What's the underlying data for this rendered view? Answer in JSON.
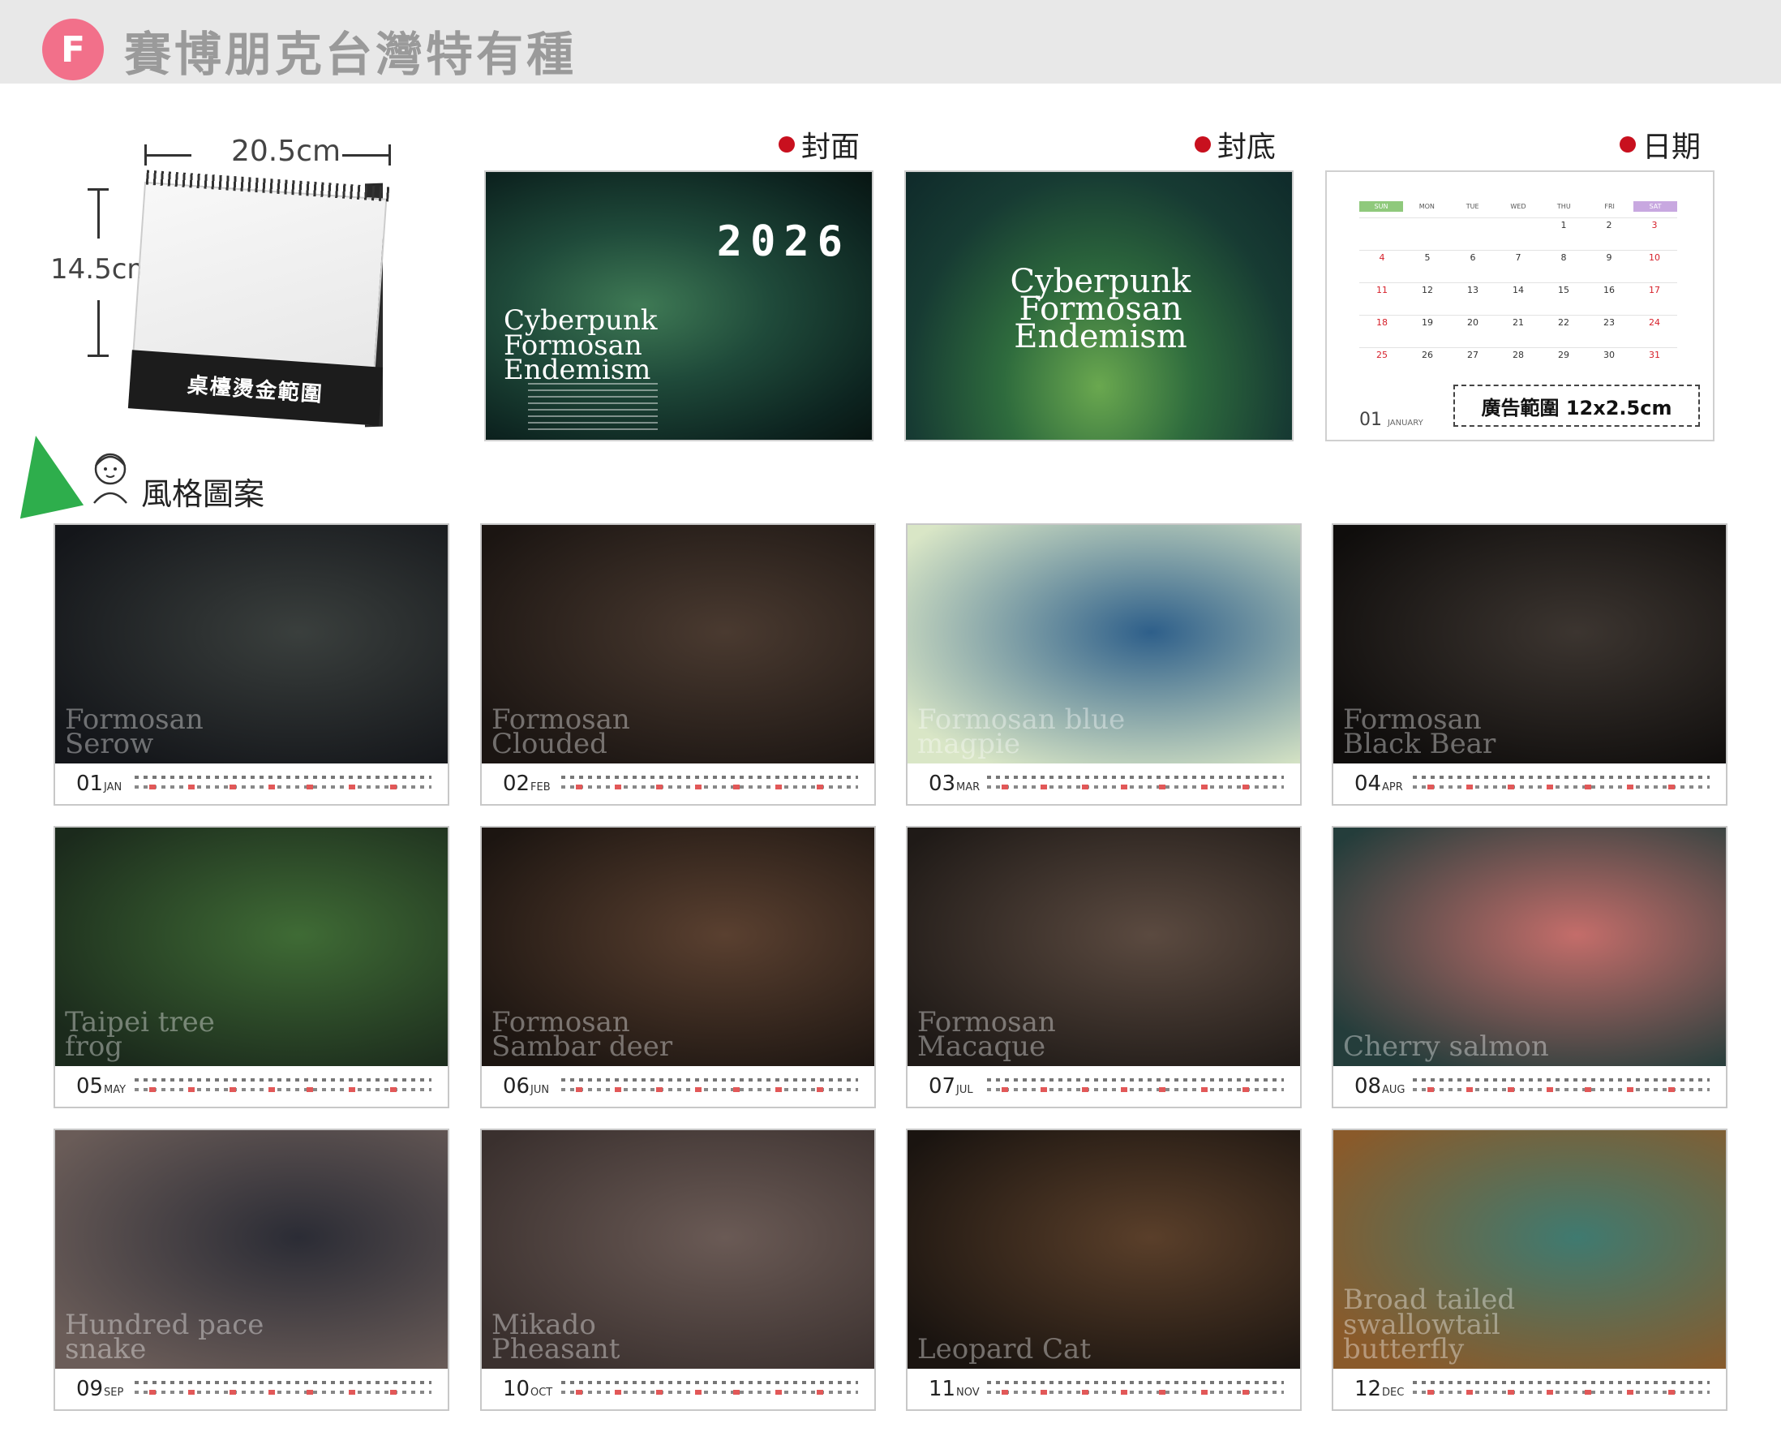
{
  "header": {
    "badge": "F",
    "title": "賽博朋克台灣特有種"
  },
  "mockup": {
    "width_label": "20.5cm",
    "height_label": "14.5cm",
    "base_text": "桌檯燙金範圍"
  },
  "panels": {
    "cover": {
      "label": "封面",
      "year": "2026",
      "title_lines": [
        "Cyberpunk",
        "Formosan",
        "Endemism"
      ]
    },
    "back": {
      "label": "封底",
      "title_lines": [
        "Cyberpunk",
        "Formosan",
        "Endemism"
      ]
    },
    "date": {
      "label": "日期",
      "weekdays": [
        "SUN",
        "MON",
        "TUE",
        "WED",
        "THU",
        "FRI",
        "SAT"
      ],
      "days": [
        "",
        "",
        "",
        "",
        "1",
        "2",
        "3",
        "4",
        "5",
        "6",
        "7",
        "8",
        "9",
        "10",
        "11",
        "12",
        "13",
        "14",
        "15",
        "16",
        "17",
        "18",
        "19",
        "20",
        "21",
        "22",
        "23",
        "24",
        "25",
        "26",
        "27",
        "28",
        "29",
        "30",
        "31"
      ],
      "month_num": "01",
      "month_name": "JANUARY",
      "ad_text": "廣告範圍 12x2.5cm"
    }
  },
  "style_section": {
    "label": "風格圖案"
  },
  "months": [
    {
      "num": "01",
      "abbr": "JAN",
      "name": "Formosan Serow",
      "colors": [
        "#3a3f3d",
        "#14161a"
      ]
    },
    {
      "num": "02",
      "abbr": "FEB",
      "name": "Formosan Clouded",
      "colors": [
        "#4a3a30",
        "#1b1512"
      ]
    },
    {
      "num": "03",
      "abbr": "MAR",
      "name": "Formosan blue magpie",
      "colors": [
        "#2e5f8a",
        "#d9e6c6"
      ]
    },
    {
      "num": "04",
      "abbr": "APR",
      "name": "Formosan Black Bear",
      "colors": [
        "#3c3530",
        "#0f0d0c"
      ]
    },
    {
      "num": "05",
      "abbr": "MAY",
      "name": "Taipei tree frog",
      "colors": [
        "#3f6b35",
        "#1b2a1c"
      ]
    },
    {
      "num": "06",
      "abbr": "JUN",
      "name": "Formosan Sambar deer",
      "colors": [
        "#5a4030",
        "#1c1511"
      ]
    },
    {
      "num": "07",
      "abbr": "JUL",
      "name": "Formosan Macaque",
      "colors": [
        "#5b4a40",
        "#1f1a17"
      ]
    },
    {
      "num": "08",
      "abbr": "AUG",
      "name": "Cherry salmon",
      "colors": [
        "#c46d6a",
        "#243d3b"
      ]
    },
    {
      "num": "09",
      "abbr": "SEP",
      "name": "Hundred pace snake",
      "colors": [
        "#2b2c35",
        "#6a5c58"
      ]
    },
    {
      "num": "10",
      "abbr": "OCT",
      "name": "Mikado Pheasant",
      "colors": [
        "#6a5a55",
        "#3a302e"
      ]
    },
    {
      "num": "11",
      "abbr": "NOV",
      "name": "Leopard Cat",
      "colors": [
        "#5a3f2a",
        "#1a1410"
      ]
    },
    {
      "num": "12",
      "abbr": "DEC",
      "name": "Broad tailed swallowtail butterfly",
      "colors": [
        "#3f7a70",
        "#8a5a2a"
      ]
    }
  ]
}
